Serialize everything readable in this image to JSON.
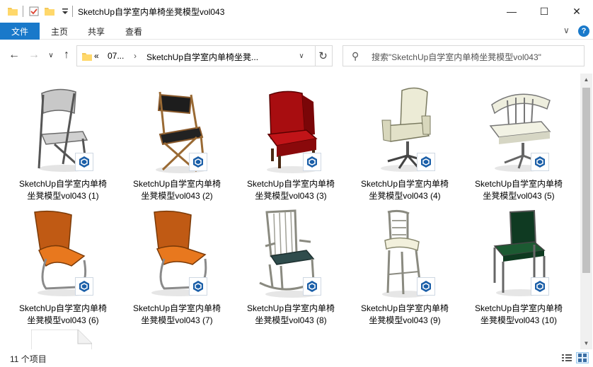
{
  "window": {
    "title": "SketchUp自学室内单椅坐凳模型vol043",
    "minimize_glyph": "—",
    "maximize_glyph": "☐",
    "close_glyph": "✕"
  },
  "ribbon": {
    "tabs": [
      {
        "label": "文件",
        "active": true
      },
      {
        "label": "主页"
      },
      {
        "label": "共享"
      },
      {
        "label": "查看"
      }
    ],
    "expand_glyph": "∨",
    "help_glyph": "?"
  },
  "nav": {
    "back_glyph": "←",
    "forward_glyph": "→",
    "recent_glyph": "∨",
    "up_glyph": "↑"
  },
  "address": {
    "overflow": "«",
    "segments": [
      "07...",
      "SketchUp自学室内单椅坐凳..."
    ],
    "separator": "›",
    "dropdown_glyph": "∨",
    "refresh_glyph": "↻"
  },
  "search": {
    "placeholder": "搜索\"SketchUp自学室内单椅坐凳模型vol043\""
  },
  "files": [
    {
      "name_line1": "SketchUp自学室内单椅",
      "name_line2": "坐凳模型vol043 (1)",
      "icon": "folding-chair-thumbnail"
    },
    {
      "name_line1": "SketchUp自学室内单椅",
      "name_line2": "坐凳模型vol043 (2)",
      "icon": "director-chair-thumbnail"
    },
    {
      "name_line1": "SketchUp自学室内单椅",
      "name_line2": "坐凳模型vol043 (3)",
      "icon": "red-wingback-chair-thumbnail"
    },
    {
      "name_line1": "SketchUp自学室内单椅",
      "name_line2": "坐凳模型vol043 (4)",
      "icon": "office-chair-thumbnail"
    },
    {
      "name_line1": "SketchUp自学室内单椅",
      "name_line2": "坐凳模型vol043 (5)",
      "icon": "swivel-armchair-thumbnail"
    },
    {
      "name_line1": "SketchUp自学室内单椅",
      "name_line2": "坐凳模型vol043 (6)",
      "icon": "orange-cantilever-chair-thumbnail"
    },
    {
      "name_line1": "SketchUp自学室内单椅",
      "name_line2": "坐凳模型vol043 (7)",
      "icon": "orange-cantilever-chair-thumbnail"
    },
    {
      "name_line1": "SketchUp自学室内单椅",
      "name_line2": "坐凳模型vol043 (8)",
      "icon": "rocking-chair-thumbnail"
    },
    {
      "name_line1": "SketchUp自学室内单椅",
      "name_line2": "坐凳模型vol043 (9)",
      "icon": "bar-stool-thumbnail"
    },
    {
      "name_line1": "SketchUp自学室内单椅",
      "name_line2": "坐凳模型vol043 (10)",
      "icon": "green-chair-thumbnail"
    }
  ],
  "status": {
    "item_count": "11 个项目"
  },
  "colors": {
    "accent": "#1979ca",
    "sketchup_badge": "#1b5fa8"
  }
}
